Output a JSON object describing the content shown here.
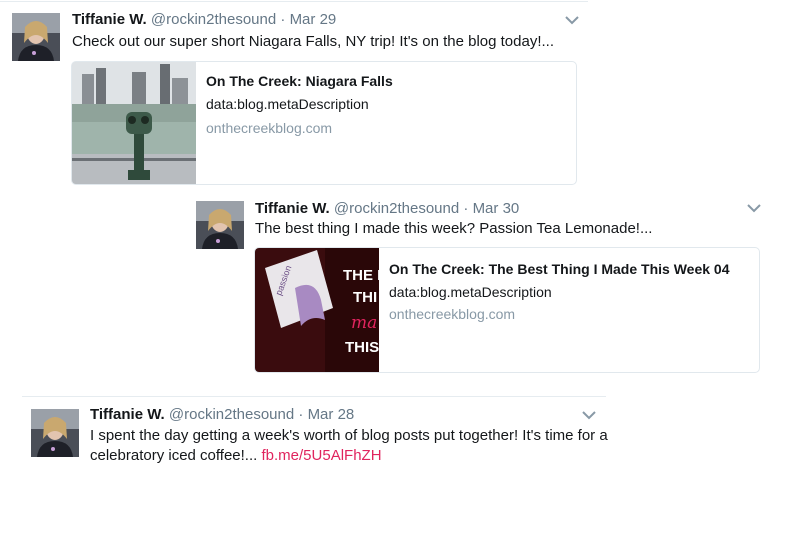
{
  "tweets": [
    {
      "name": "Tiffanie W.",
      "handle": "@rockin2thesound",
      "dot": "·",
      "date": "Mar 29",
      "text": "Check out our super short Niagara Falls, NY trip!  It's on the blog today!...",
      "card": {
        "title": "On The Creek: Niagara Falls",
        "description": "data:blog.metaDescription",
        "url": "onthecreekblog.com"
      }
    },
    {
      "name": "Tiffanie W.",
      "handle": "@rockin2thesound",
      "dot": "·",
      "date": "Mar 30",
      "text": "The best thing I made this week?  Passion Tea Lemonade!...",
      "card": {
        "title": "On The Creek: The Best Thing I Made This Week 04",
        "description": "data:blog.metaDescription",
        "url": "onthecreekblog.com",
        "image_words": [
          "THE BE",
          "THI",
          "ma",
          "THIS",
          "passion"
        ]
      }
    },
    {
      "name": "Tiffanie W.",
      "handle": "@rockin2thesound",
      "dot": "·",
      "date": "Mar 28",
      "text_line1": "I spent the day getting a week's worth of blog posts put together!  It's time for a",
      "text_line2": "celebratory iced coffee!...",
      "link": "fb.me/5U5AlFhZH"
    }
  ],
  "colors": {
    "name": "#14171a",
    "meta": "#657786",
    "link": "#e0245e",
    "url": "#8899a6",
    "border": "#e1e8ed"
  },
  "icons": [
    "avatar-photo",
    "chevron-down-icon"
  ]
}
